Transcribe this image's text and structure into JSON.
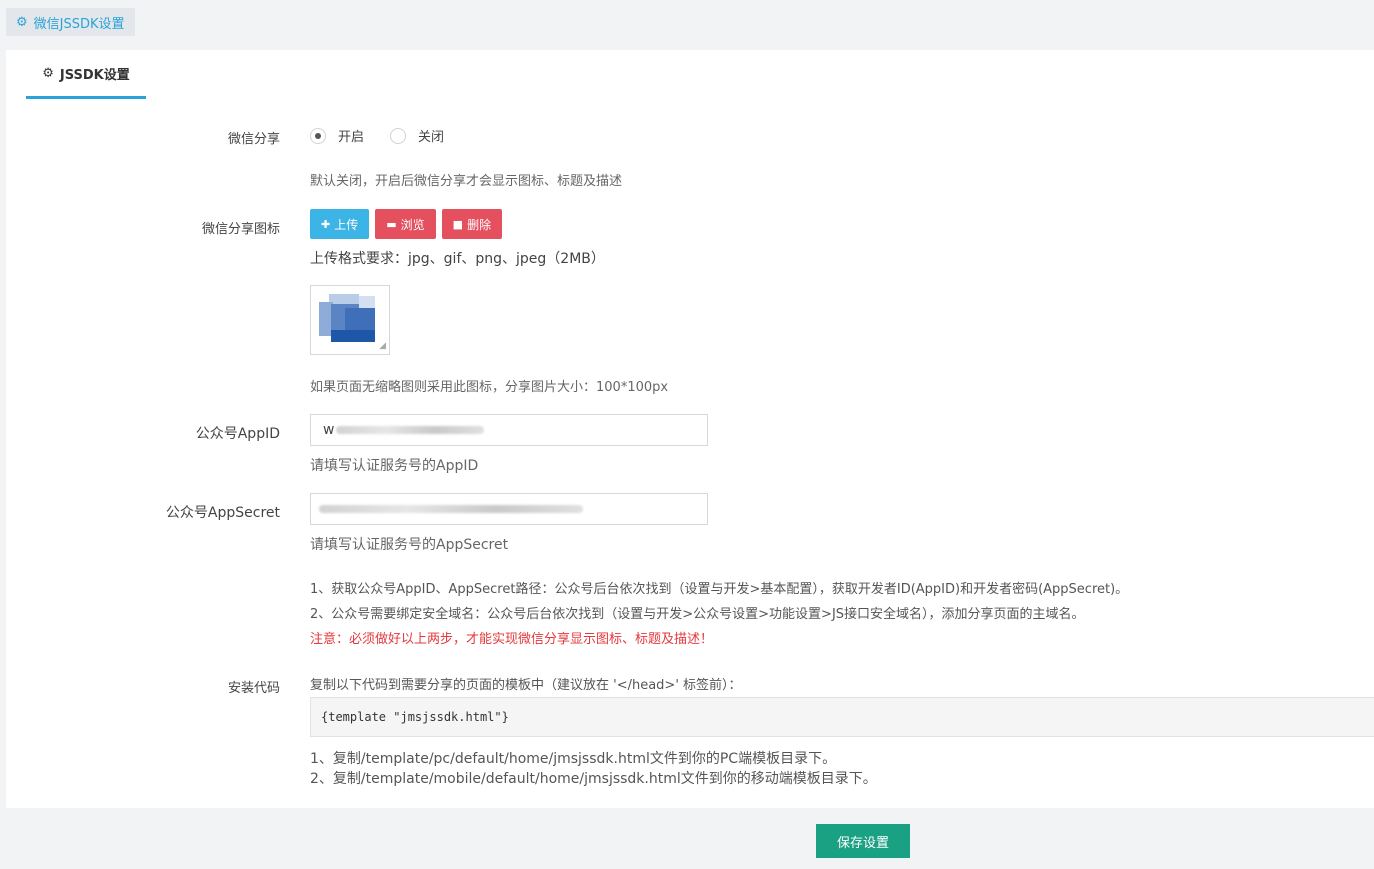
{
  "top_tab": {
    "label": "微信JSSDK设置",
    "icon": "gear-icon"
  },
  "sub_tab": {
    "label": "JSSDK设置",
    "icon": "gear-icon"
  },
  "share": {
    "label": "微信分享",
    "options": [
      {
        "label": "开启",
        "selected": true
      },
      {
        "label": "关闭",
        "selected": false
      }
    ],
    "help": "默认关闭，开启后微信分享才会显示图标、标题及描述"
  },
  "share_icon": {
    "label": "微信分享图标",
    "buttons": {
      "upload": "上传",
      "browse": "浏览",
      "delete": "删除"
    },
    "format_text": "上传格式要求：jpg、gif、png、jpeg（2MB）",
    "help": "如果页面无缩略图则采用此图标，分享图片大小：100*100px"
  },
  "appid": {
    "label": "公众号AppID",
    "value_prefix": "w",
    "help": "请填写认证服务号的AppID"
  },
  "appsecret": {
    "label": "公众号AppSecret",
    "help": "请填写认证服务号的AppSecret"
  },
  "notes": {
    "line1": "1、获取公众号AppID、AppSecret路径：公众号后台依次找到（设置与开发>基本配置），获取开发者ID(AppID)和开发者密码(AppSecret)。",
    "line2": "2、公众号需要绑定安全域名：公众号后台依次找到（设置与开发>公众号设置>功能设置>JS接口安全域名），添加分享页面的主域名。",
    "warning": "注意：必须做好以上两步，才能实现微信分享显示图标、标题及描述！"
  },
  "install": {
    "label": "安装代码",
    "intro": "复制以下代码到需要分享的页面的模板中（建议放在 '</head>' 标签前）：",
    "code": "{template \"jmsjssdk.html\"}",
    "step1": "1、复制/template/pc/default/home/jmsjssdk.html文件到你的PC端模板目录下。",
    "step2": "2、复制/template/mobile/default/home/jmsjssdk.html文件到你的移动端模板目录下。"
  },
  "footer": {
    "save_label": "保存设置"
  },
  "colors": {
    "accent": "#2aa4d8",
    "save": "#1aa083",
    "danger": "#e5505f",
    "upload": "#3cb5e6",
    "warning": "#e4393c"
  }
}
